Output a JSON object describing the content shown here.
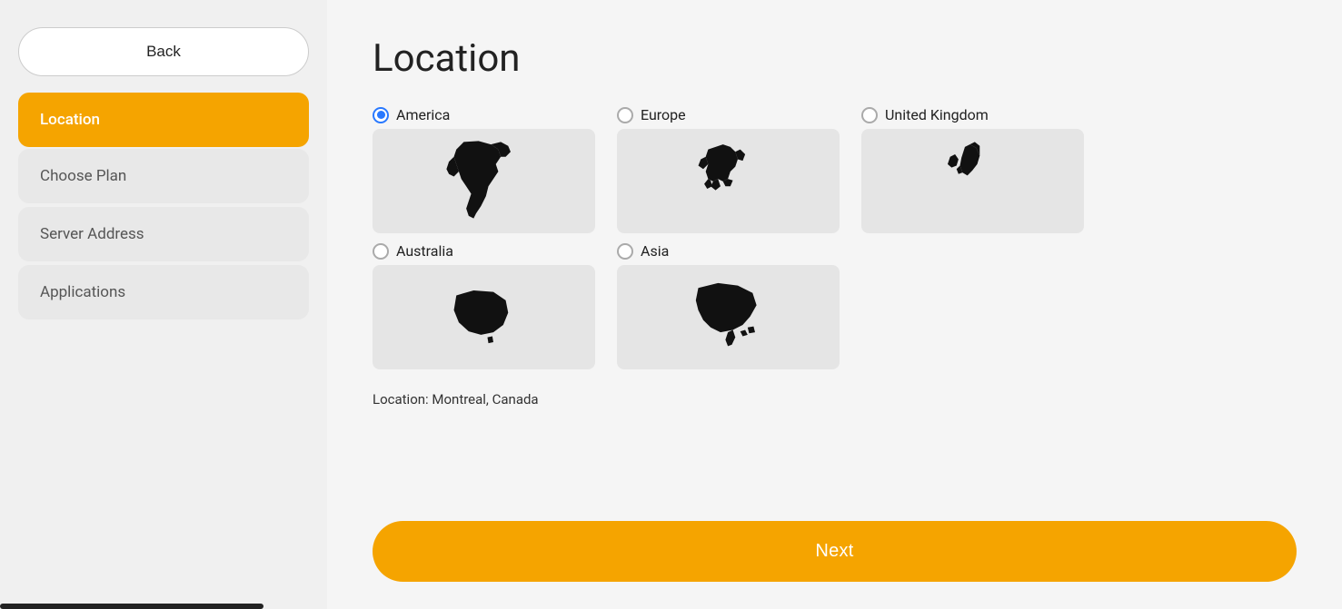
{
  "sidebar": {
    "back_label": "Back",
    "nav_items": [
      {
        "id": "location",
        "label": "Location",
        "active": true
      },
      {
        "id": "choose-plan",
        "label": "Choose Plan",
        "active": false
      },
      {
        "id": "server-address",
        "label": "Server Address",
        "active": false
      },
      {
        "id": "applications",
        "label": "Applications",
        "active": false
      }
    ]
  },
  "main": {
    "title": "Location",
    "regions": [
      {
        "row": 0,
        "items": [
          {
            "id": "america",
            "label": "America",
            "selected": true
          },
          {
            "id": "europe",
            "label": "Europe",
            "selected": false
          },
          {
            "id": "united-kingdom",
            "label": "United Kingdom",
            "selected": false
          }
        ]
      },
      {
        "row": 1,
        "items": [
          {
            "id": "australia",
            "label": "Australia",
            "selected": false
          },
          {
            "id": "asia",
            "label": "Asia",
            "selected": false
          }
        ]
      }
    ],
    "location_text": "Location: Montreal, Canada",
    "next_label": "Next"
  },
  "colors": {
    "accent": "#f5a400",
    "active_radio": "#2979ff"
  }
}
